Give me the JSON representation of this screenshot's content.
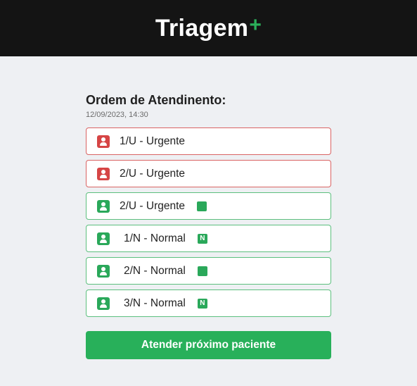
{
  "header": {
    "brand_name": "Triagem",
    "brand_mark": "+"
  },
  "queue": {
    "title": "Ordem de Atendinento:",
    "timestamp": "12/09/2023, 14:30",
    "items": [
      {
        "label": "1/U - Urgente",
        "priority": "urgent",
        "icon": "person-icon",
        "badge": ""
      },
      {
        "label": "2/U - Urgente",
        "priority": "urgent",
        "icon": "person-icon",
        "badge": ""
      },
      {
        "label": "2/U - Urgente",
        "priority": "normal",
        "icon": "person-icon",
        "badge": ""
      },
      {
        "label": "1/N - Normal",
        "priority": "normal",
        "icon": "person-icon",
        "badge": "N"
      },
      {
        "label": "2/N - Normal",
        "priority": "normal",
        "icon": "person-icon",
        "badge": ""
      },
      {
        "label": "3/N - Normal",
        "priority": "normal",
        "icon": "person-icon",
        "badge": "N"
      }
    ]
  },
  "actions": {
    "next_patient_label": "Atender próximo paciente"
  },
  "colors": {
    "header_bg": "#141414",
    "accent_green": "#28b05a",
    "urgent_red": "#d64545",
    "page_bg": "#eef0f3"
  }
}
